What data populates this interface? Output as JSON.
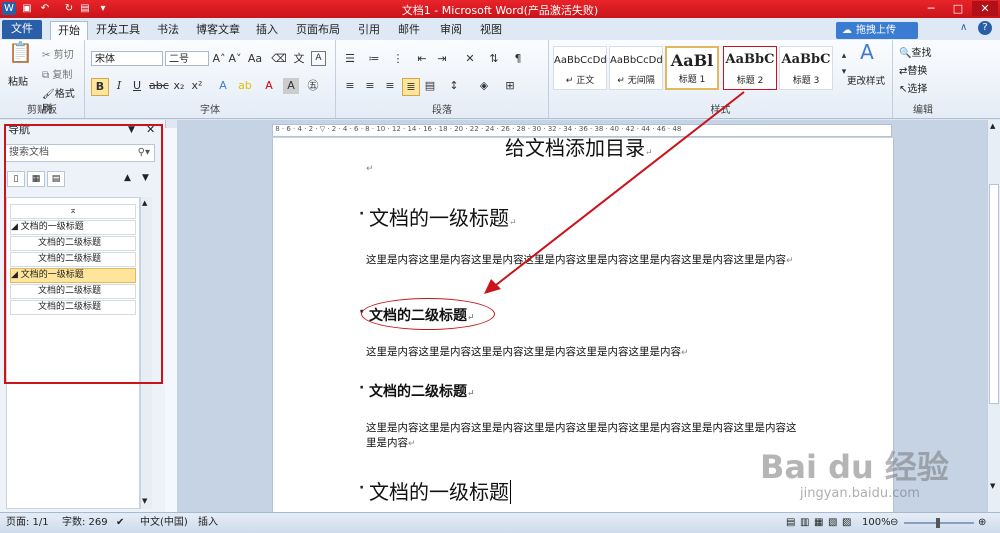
{
  "titlebar": {
    "title": "文档1 - Microsoft Word(产品激活失败)"
  },
  "tabs": [
    {
      "label": "文件"
    },
    {
      "label": "开始"
    },
    {
      "label": "开发工具"
    },
    {
      "label": "书法"
    },
    {
      "label": "博客文章"
    },
    {
      "label": "插入"
    },
    {
      "label": "页面布局"
    },
    {
      "label": "引用"
    },
    {
      "label": "邮件"
    },
    {
      "label": "审阅"
    },
    {
      "label": "视图"
    }
  ],
  "upload_label": "拖拽上传",
  "ribbon": {
    "clipboard": {
      "paste": "粘贴",
      "cut": "剪切",
      "copy": "复制",
      "format_painter": "格式刷",
      "label": "剪贴板"
    },
    "font": {
      "family": "宋体",
      "size": "二号",
      "label": "字体"
    },
    "paragraph": {
      "label": "段落"
    },
    "styles": {
      "label": "样式",
      "items": [
        {
          "preview": "AaBbCcDd",
          "name": "↵ 正文"
        },
        {
          "preview": "AaBbCcDd",
          "name": "↵ 无间隔"
        },
        {
          "preview": "AaBl",
          "name": "标题 1"
        },
        {
          "preview": "AaBbC",
          "name": "标题 2"
        },
        {
          "preview": "AaBbC",
          "name": "标题 3"
        }
      ],
      "change": "更改样式"
    },
    "editing": {
      "find": "查找",
      "replace": "替换",
      "select": "选择",
      "label": "编辑"
    }
  },
  "nav": {
    "title": "导航",
    "search_placeholder": "搜索文档",
    "headings": [
      {
        "text": "文档的一级标题",
        "level": 1,
        "selected": false
      },
      {
        "text": "文档的二级标题",
        "level": 2,
        "selected": false
      },
      {
        "text": "文档的二级标题",
        "level": 2,
        "selected": false
      },
      {
        "text": "文档的一级标题",
        "level": 1,
        "selected": true
      },
      {
        "text": "文档的二级标题",
        "level": 2,
        "selected": false
      },
      {
        "text": "文档的二级标题",
        "level": 2,
        "selected": false
      }
    ]
  },
  "document": {
    "title_partial": "给文档添加目录",
    "h1_a": "文档的一级标题",
    "body1": "这里是内容这里是内容这里是内容这里是内容这里是内容这里是内容这里是内容这里是内容",
    "h2_a": "文档的二级标题",
    "body2": "这里是内容这里是内容这里是内容这里是内容这里是内容这里是内容",
    "h2_b": "文档的二级标题",
    "body3": "这里是内容这里是内容这里是内容这里是内容这里是内容这里是内容这里是内容这里是内容这里是内容",
    "h1_b": "文档的一级标题"
  },
  "status": {
    "page": "页面: 1/1",
    "words": "字数: 269",
    "lang": "中文(中国)",
    "mode": "插入",
    "zoom": "100%"
  },
  "watermark": {
    "brand": "Bai du 经验",
    "url": "jingyan.baidu.com"
  },
  "colors": {
    "titlebar": "#c8141a",
    "annotation": "#c8141a",
    "file_tab": "#2a5fa8"
  }
}
